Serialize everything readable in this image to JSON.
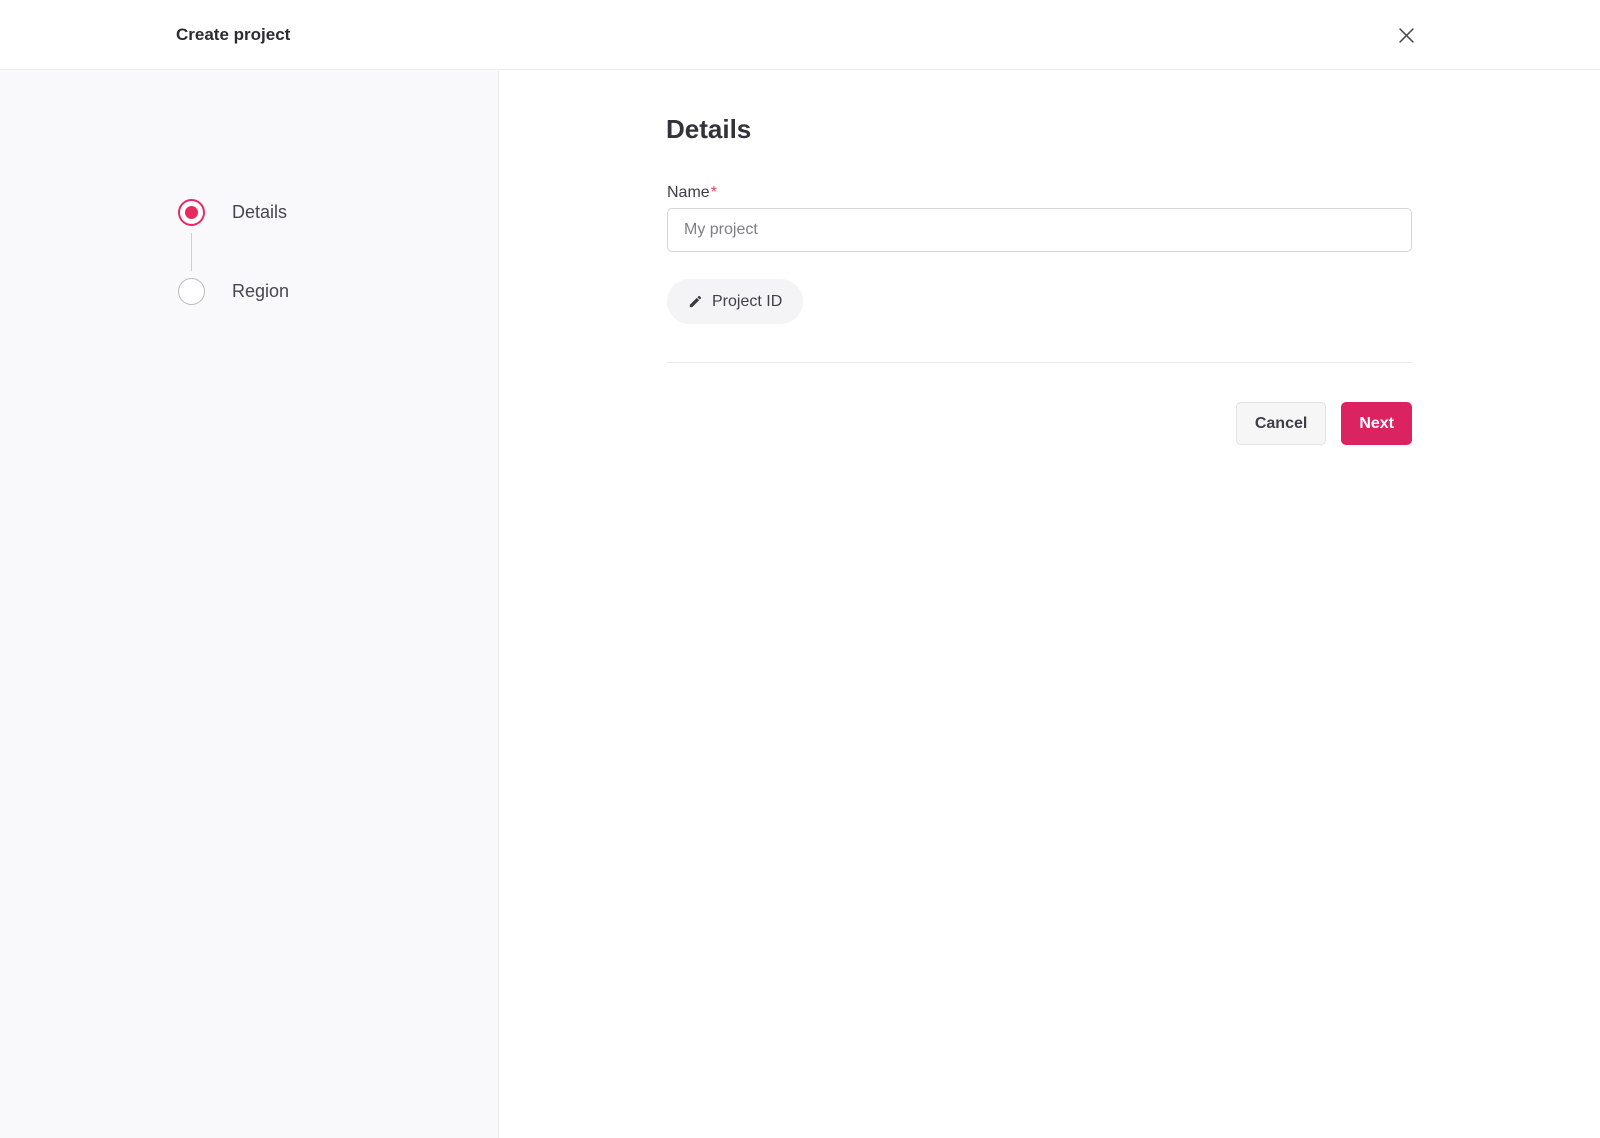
{
  "header": {
    "title": "Create project"
  },
  "stepper": {
    "steps": [
      {
        "label": "Details",
        "state": "active"
      },
      {
        "label": "Region",
        "state": "upcoming"
      }
    ]
  },
  "form": {
    "heading": "Details",
    "name_label": "Name",
    "required_marker": "*",
    "name_value": "",
    "name_placeholder": "My project",
    "project_id_button": "Project ID"
  },
  "actions": {
    "cancel": "Cancel",
    "next": "Next"
  },
  "icons": {
    "close": "close-icon",
    "pencil": "pencil-icon",
    "active_step_radio": "radio-selected-icon",
    "inactive_step_radio": "radio-unselected-icon"
  },
  "colors": {
    "primary_button": "#da2360",
    "radio_active": "#e72a60",
    "required_marker": "#e5484d",
    "sidebar_background": "#f9f9fb",
    "border": "#e9e9ec",
    "header_border": "#ebebee"
  }
}
